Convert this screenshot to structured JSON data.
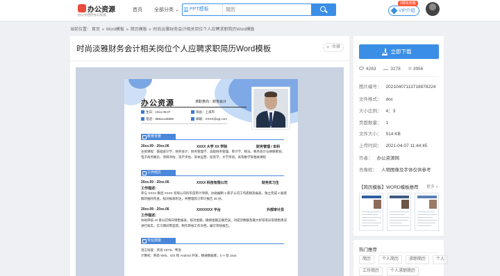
{
  "header": {
    "logo_name": "办公资源",
    "logo_slogan": "办公文档存办公资源",
    "nav_home": "首页",
    "nav_category": "全部分类",
    "search_type": "PPT模板",
    "search_placeholder": "简历",
    "vip_label": "VIP介绍",
    "vip_badge": "2周年庆典"
  },
  "breadcrumb": {
    "prefix": "当前位置：",
    "items": [
      "首页",
      "Word模板",
      "简历模板",
      "时尚淡雅财务会计相关岗位个人应聘求职简历Word模板"
    ],
    "sep": " » "
  },
  "main": {
    "title": "时尚淡雅财务会计相关岗位个人应聘求职简历Word模板",
    "fav_label": "收藏"
  },
  "resume": {
    "name": "办公资源",
    "intent": "求职意向：财务会计",
    "info": [
      {
        "label": "生日：19xx.05.07"
      },
      {
        "label": "现居：上海市"
      },
      {
        "label": "电话：888xxxx8888"
      },
      {
        "label": "邮箱：XXXX@qq.com"
      }
    ],
    "sections": {
      "education": "教育背景",
      "work": "工作经历",
      "skills": "专业技能"
    },
    "edu_date": "20xx.09 - 20xx.06",
    "edu_school": "XXXX 大学 XX 学院",
    "edu_major": "财务管理 / 本科",
    "edu_desc": "主修课程：基础会计学、财务会计、财务管理学、高级财务管理、审计学、税法、税务会计与纳税筹划、电子商务概论、项目评估、资产评估、资本运营、投资学、大学英语、高等数学等相关课程",
    "job1_date": "20xx.09 - 20xx.06",
    "job1_company": "XXXX 科技有限公司",
    "job1_role": "财务实习生",
    "job1_desc_label": "工作描述：",
    "job1_desc": "参与 XXXX 集团 XXXX 有限公司的年度审计项目，协助编制 3 家子公司工作底稿及报表，独立完成 4 册底稿的抽凭检查，核对报表附注，并整理装订审计报告 35 份。",
    "job2_date": "20xx.09 - 20xx.06",
    "job2_company": "XXXXXXX 平台",
    "job2_role": "外部审计员",
    "job2_desc_label": "工作描述：",
    "job2_desc": "协助审核 10 家分店每日销售报表，核对金额，确保金额正确无误，对提货数额及最大折扣等异常销售情况进行核实，实习期间零差错，制作审核工作文档，编写审核报告。",
    "skills_lang": "语言技能：英语 CET6、粤语",
    "skills_prog": "计算机：熟悉 Web、iOS 和 Android 开发，精通数据库，C++及 Java"
  },
  "sidebar": {
    "download_label": "立即下载",
    "views": "4283",
    "downloads": "3278",
    "likes": "3956",
    "meta": [
      {
        "k": "图片编号：",
        "v": "20210407113718978224"
      },
      {
        "k": "文件格式：",
        "v": "doc"
      },
      {
        "k": "大小比例：",
        "v": "4：3"
      },
      {
        "k": "页面数量：",
        "v": "1"
      },
      {
        "k": "文件大小：",
        "v": "514 KB"
      },
      {
        "k": "上传时间：",
        "v": "2021-04-07 11:44:45"
      },
      {
        "k": "作者：",
        "v": "办公资源网"
      },
      {
        "k": "肖像权：",
        "v": "人物图像及字体仅供参考"
      }
    ],
    "related_title": "【简历模板】WORD模板推荐",
    "related_more": "更多 »",
    "hot_title": "热门推荐",
    "tags": [
      "简历",
      "个人简历",
      "求职简历",
      "个人",
      "工作简历",
      "个人求职简历"
    ]
  }
}
